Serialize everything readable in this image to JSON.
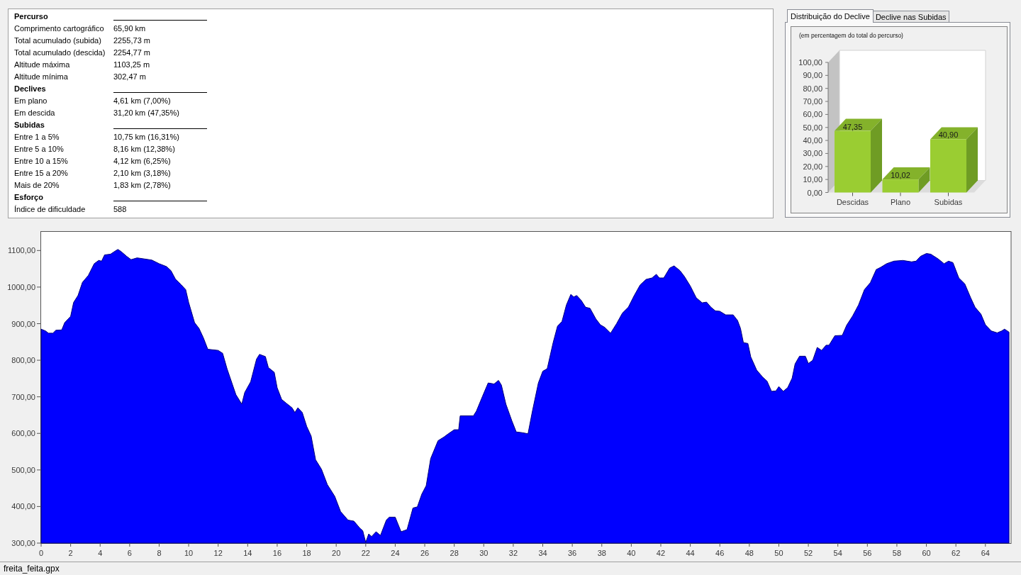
{
  "summary": {
    "sections": [
      {
        "heading": "Percurso",
        "rows": [
          {
            "label": "Comprimento cartográfico",
            "value": "65,90 km"
          },
          {
            "label": "Total acumulado (subida)",
            "value": "2255,73 m"
          },
          {
            "label": "Total acumulado (descida)",
            "value": "2254,77 m"
          },
          {
            "label": "Altitude máxima",
            "value": "1103,25 m"
          },
          {
            "label": "Altitude mínima",
            "value": "302,47 m"
          }
        ]
      },
      {
        "heading": "Declives",
        "rows": [
          {
            "label": "Em plano",
            "value": "4,61 km (7,00%)"
          },
          {
            "label": "Em descida",
            "value": "31,20 km (47,35%)"
          }
        ]
      },
      {
        "heading": "Subidas",
        "rows": [
          {
            "label": "Entre 1 a 5%",
            "value": "10,75 km (16,31%)"
          },
          {
            "label": "Entre 5 a 10%",
            "value": "8,16 km (12,38%)"
          },
          {
            "label": "Entre 10 a 15%",
            "value": "4,12 km (6,25%)"
          },
          {
            "label": "Entre 15 a 20%",
            "value": "2,10 km (3,18%)"
          },
          {
            "label": "Mais de 20%",
            "value": "1,83 km (2,78%)"
          }
        ]
      },
      {
        "heading": "Esforço",
        "rows": [
          {
            "label": "Índice de dificuldade",
            "value": "588"
          }
        ]
      }
    ]
  },
  "slope_panel": {
    "tabs": [
      {
        "label": "Distribuição do Declive",
        "selected": true
      },
      {
        "label": "Declive nas Subidas",
        "selected": false
      }
    ],
    "chart_data": {
      "type": "bar",
      "title": "(em percentagem do total do percurso)",
      "categories": [
        "Descidas",
        "Plano",
        "Subidas"
      ],
      "values": [
        47.35,
        10.02,
        40.9
      ],
      "value_labels": [
        "47,35",
        "10,02",
        "40,90"
      ],
      "ylim": [
        0,
        100
      ],
      "yticks": [
        {
          "value": 0,
          "label": "0,00"
        },
        {
          "value": 10,
          "label": "10,00"
        },
        {
          "value": 20,
          "label": "20,00"
        },
        {
          "value": 30,
          "label": "30,00"
        },
        {
          "value": 40,
          "label": "40,00"
        },
        {
          "value": 50,
          "label": "50,00"
        },
        {
          "value": 60,
          "label": "60,00"
        },
        {
          "value": 70,
          "label": "70,00"
        },
        {
          "value": 80,
          "label": "80,00"
        },
        {
          "value": 90,
          "label": "90,00"
        },
        {
          "value": 100,
          "label": "100,00"
        }
      ]
    }
  },
  "profile": {
    "chart_data": {
      "type": "area",
      "x": [
        0,
        0.3,
        0.5,
        0.8,
        1,
        1.4,
        1.6,
        2,
        2.2,
        2.5,
        2.8,
        3.2,
        3.6,
        3.9,
        4.1,
        4.3,
        4.7,
        5,
        5.2,
        5.4,
        5.8,
        6.1,
        6.5,
        7,
        7.5,
        8,
        8.5,
        8.8,
        9.1,
        9.5,
        9.8,
        10,
        10.4,
        10.7,
        11,
        11.3,
        12,
        12.3,
        12.6,
        13.2,
        13.6,
        13.8,
        14.2,
        14.6,
        14.8,
        15.2,
        15.4,
        15.8,
        16,
        16.3,
        16.6,
        17,
        17.2,
        17.4,
        17.7,
        18,
        18.3,
        18.6,
        19,
        19.4,
        19.9,
        20.3,
        20.8,
        21.2,
        21.6,
        21.8,
        22,
        22.2,
        22.4,
        22.7,
        23,
        23.4,
        23.6,
        24,
        24.4,
        24.8,
        25.2,
        25.5,
        25.8,
        26.1,
        26.4,
        26.9,
        27.3,
        27.6,
        28,
        28.3,
        28.4,
        29.3,
        29.5,
        29.9,
        30.3,
        30.7,
        31,
        31.2,
        31.5,
        31.9,
        32.2,
        32.6,
        33,
        33.3,
        33.7,
        34,
        34.3,
        34.7,
        35,
        35.3,
        35.6,
        35.9,
        36.1,
        36.3,
        36.6,
        36.9,
        37.2,
        37.6,
        37.9,
        38.2,
        38.6,
        39,
        39.4,
        39.8,
        40.2,
        40.6,
        41,
        41.4,
        41.7,
        41.9,
        42.2,
        42.6,
        42.9,
        43.3,
        43.6,
        44,
        44.4,
        44.8,
        45.1,
        45.4,
        45.7,
        46,
        46.4,
        46.9,
        47.2,
        47.4,
        47.6,
        47.9,
        48.1,
        48.5,
        48.9,
        49.2,
        49.5,
        49.8,
        50,
        50.3,
        50.6,
        50.9,
        51.1,
        51.4,
        51.8,
        52,
        52.3,
        52.6,
        52.9,
        53.2,
        53.4,
        53.8,
        54.3,
        54.6,
        55,
        55.4,
        55.8,
        56.2,
        56.6,
        56.9,
        57.3,
        57.8,
        58.4,
        59,
        59.3,
        59.6,
        60,
        60.3,
        60.8,
        61.2,
        61.5,
        61.8,
        62.2,
        62.6,
        63,
        63.3,
        63.7,
        64,
        64.4,
        64.8,
        65.1,
        65.3,
        65.6
      ],
      "values": [
        885,
        880,
        874,
        874,
        882,
        883,
        903,
        920,
        958,
        977,
        1013,
        1032,
        1064,
        1073,
        1071,
        1088,
        1090,
        1098,
        1103,
        1098,
        1084,
        1075,
        1080,
        1077,
        1074,
        1064,
        1056,
        1045,
        1022,
        1006,
        993,
        958,
        903,
        887,
        861,
        830,
        827,
        819,
        777,
        706,
        680,
        712,
        741,
        803,
        816,
        810,
        780,
        767,
        725,
        693,
        683,
        670,
        657,
        670,
        657,
        619,
        593,
        528,
        502,
        460,
        428,
        386,
        363,
        360,
        341,
        334,
        302,
        325,
        318,
        331,
        321,
        363,
        371,
        371,
        331,
        337,
        396,
        399,
        434,
        457,
        531,
        580,
        590,
        599,
        610,
        610,
        648,
        648,
        661,
        700,
        738,
        735,
        745,
        732,
        680,
        635,
        604,
        602,
        599,
        661,
        738,
        770,
        777,
        848,
        893,
        906,
        951,
        980,
        973,
        977,
        964,
        945,
        942,
        913,
        897,
        890,
        874,
        900,
        929,
        945,
        977,
        1006,
        1021,
        1025,
        1035,
        1025,
        1025,
        1052,
        1058,
        1045,
        1029,
        1003,
        971,
        957,
        959,
        945,
        935,
        934,
        924,
        924,
        909,
        887,
        848,
        846,
        809,
        773,
        754,
        743,
        715,
        716,
        728,
        715,
        725,
        751,
        790,
        811,
        811,
        791,
        800,
        835,
        827,
        841,
        841,
        867,
        868,
        896,
        921,
        951,
        993,
        1012,
        1048,
        1054,
        1064,
        1071,
        1073,
        1069,
        1071,
        1084,
        1092,
        1090,
        1077,
        1064,
        1071,
        1067,
        1025,
        1009,
        971,
        945,
        926,
        897,
        880,
        875,
        880,
        885,
        877
      ],
      "xlim": [
        0,
        65.74
      ],
      "ylim": [
        300,
        1153
      ],
      "xticks": [
        0,
        2,
        4,
        6,
        8,
        10,
        12,
        14,
        16,
        18,
        20,
        22,
        24,
        26,
        28,
        30,
        32,
        34,
        36,
        38,
        40,
        42,
        44,
        46,
        48,
        50,
        52,
        54,
        56,
        58,
        60,
        62,
        64
      ],
      "yticks": [
        {
          "value": 300,
          "label": "300,00"
        },
        {
          "value": 400,
          "label": "400,00"
        },
        {
          "value": 500,
          "label": "500,00"
        },
        {
          "value": 600,
          "label": "600,00"
        },
        {
          "value": 700,
          "label": "700,00"
        },
        {
          "value": 800,
          "label": "800,00"
        },
        {
          "value": 900,
          "label": "900,00"
        },
        {
          "value": 1000,
          "label": "1000,00"
        },
        {
          "value": 1100,
          "label": "1100,00"
        }
      ]
    }
  },
  "status_bar": {
    "file_name": "freita_feita.gpx"
  }
}
